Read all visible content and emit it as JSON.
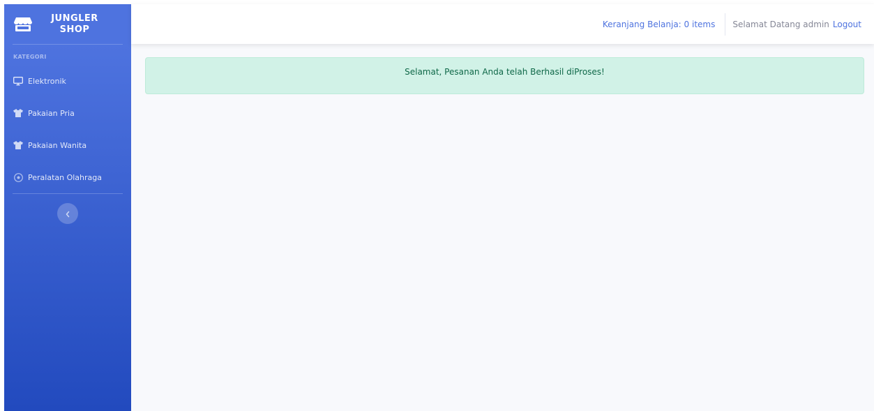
{
  "brand": {
    "line1": "JUNGLER",
    "line2": "SHOP",
    "icon": "store-icon"
  },
  "sidebar": {
    "heading": "KATEGORI",
    "items": [
      {
        "label": "Elektronik",
        "icon": "desktop-icon"
      },
      {
        "label": "Pakaian Pria",
        "icon": "tshirt-icon"
      },
      {
        "label": "Pakaian Wanita",
        "icon": "tshirt-icon"
      },
      {
        "label": "Peralatan Olahraga",
        "icon": "football-icon"
      }
    ],
    "toggle_icon": "chevron-left-icon"
  },
  "topbar": {
    "cart_label": "Keranjang Belanja: 0 items",
    "welcome_text": "Selamat Datang admin",
    "logout_label": "Logout"
  },
  "alert": {
    "message": "Selamat, Pesanan Anda telah Berhasil diProses!"
  },
  "colors": {
    "sidebar_top": "#4e73df",
    "sidebar_bottom": "#224abe",
    "link": "#4e73df",
    "alert_bg": "#d1f2e7",
    "alert_text": "#0f6848",
    "content_bg": "#f8f9fc"
  }
}
